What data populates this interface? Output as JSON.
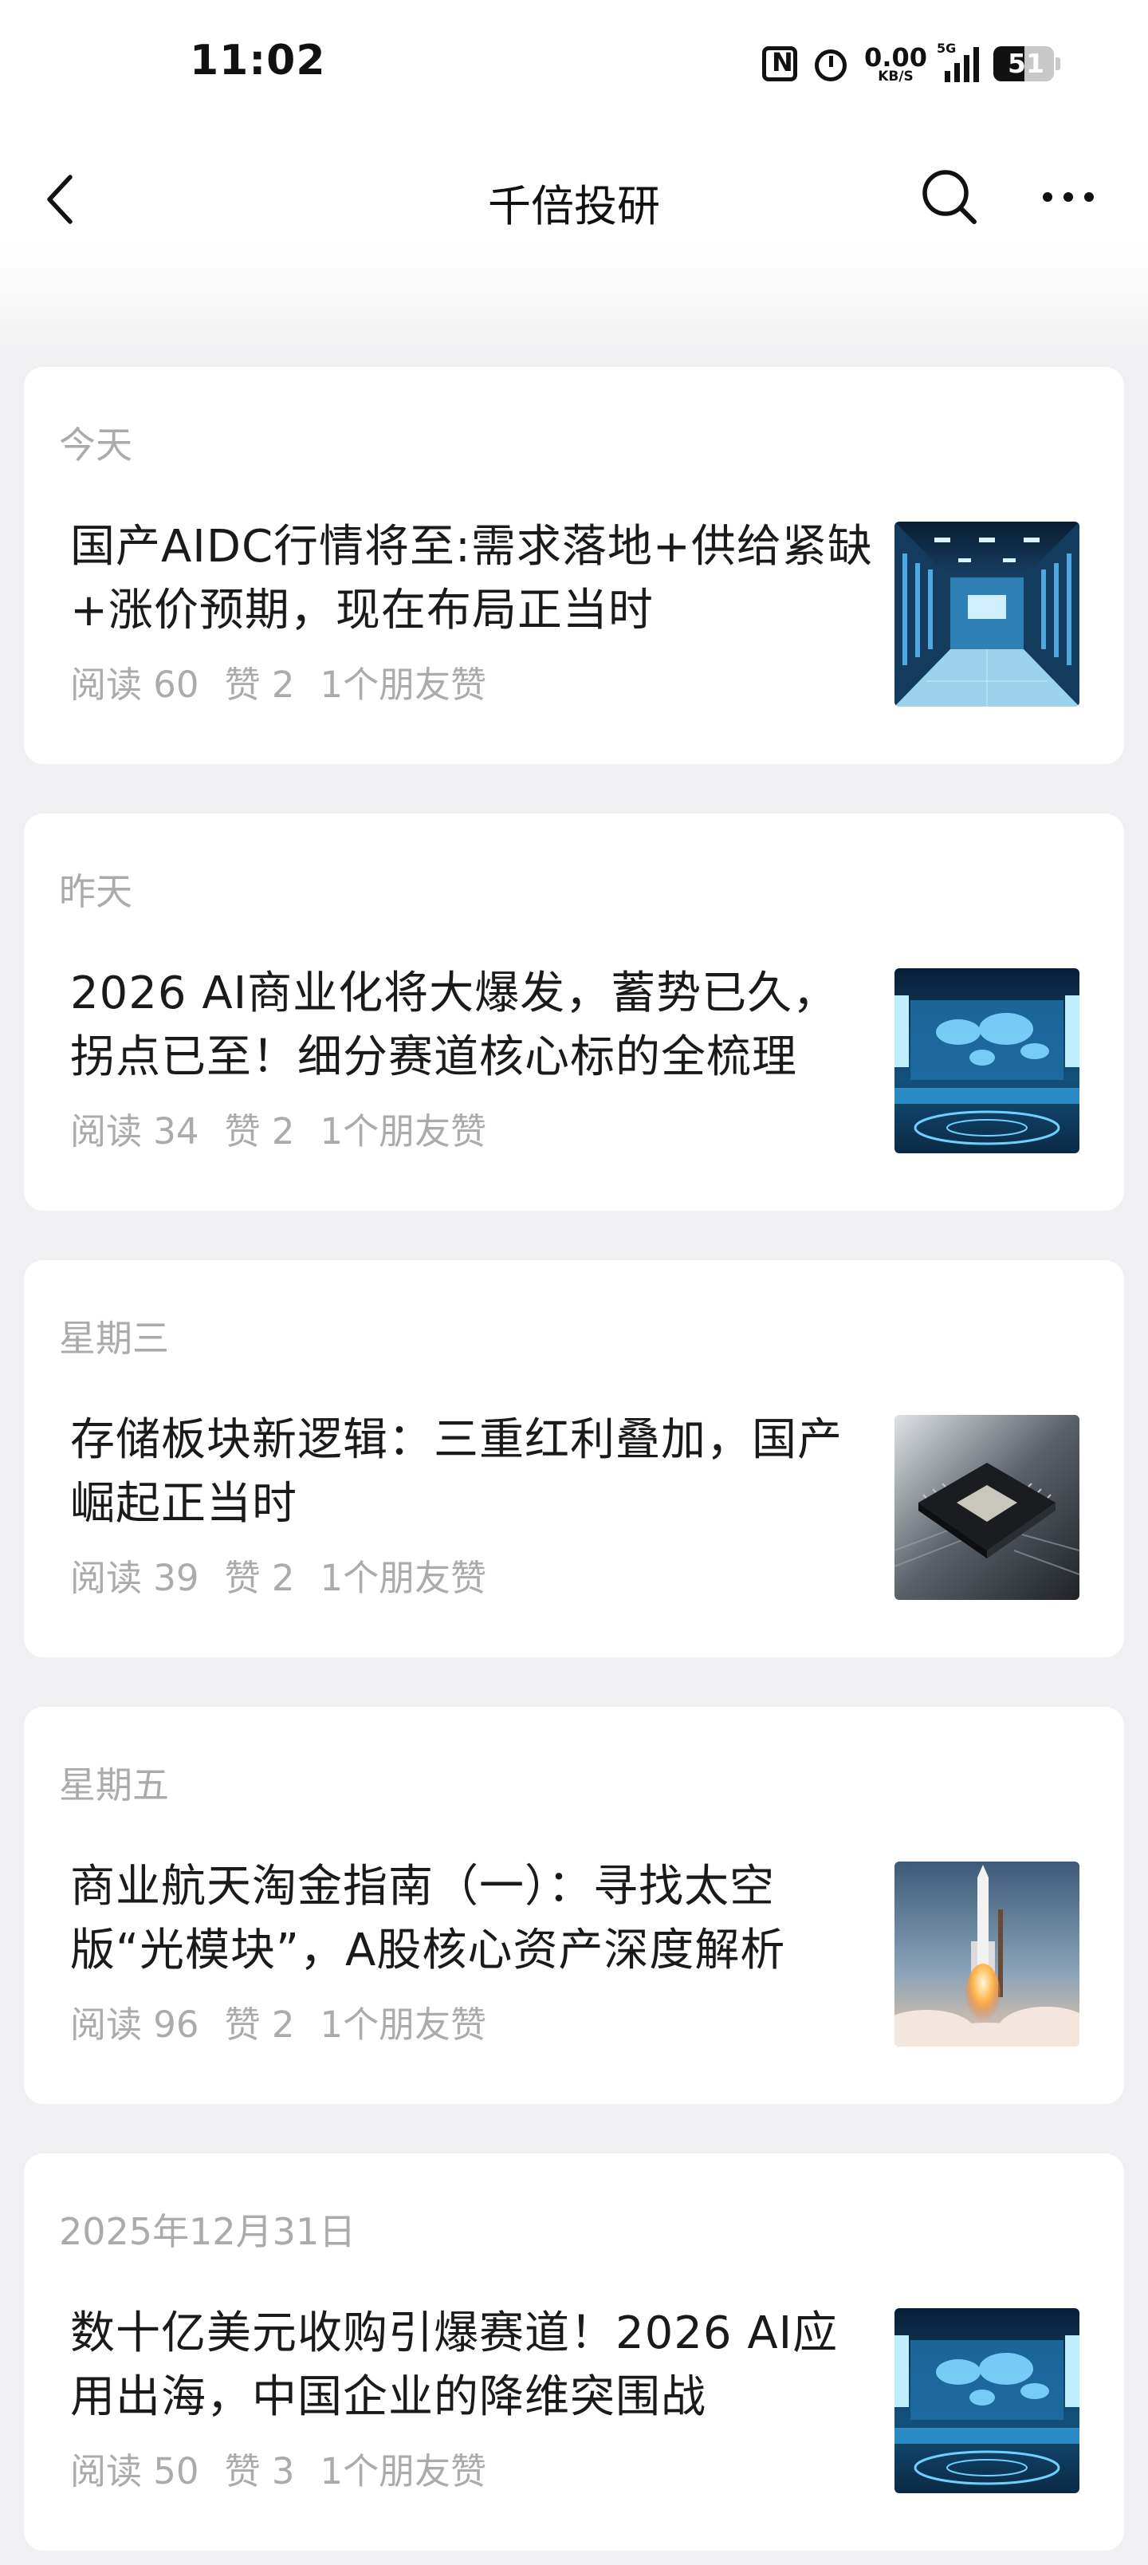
{
  "status": {
    "time": "11:02",
    "net_speed_value": "0.00",
    "net_speed_unit": "KB/S",
    "network": "5G",
    "battery": "51",
    "battery_level_percent": 51
  },
  "nav": {
    "title": "千倍投研"
  },
  "articles": [
    {
      "date": "今天",
      "title": "国产AIDC行情将至:需求落地+供给紧缺+涨价预期，现在布局正当时",
      "reads": "阅读 60",
      "likes": "赞 2",
      "friends": "1个朋友赞",
      "image": "data-center-corridor"
    },
    {
      "date": "昨天",
      "title": "2026 AI商业化将大爆发，蓄势已久，拐点已至！细分赛道核心标的全梳理",
      "reads": "阅读 34",
      "likes": "赞 2",
      "friends": "1个朋友赞",
      "image": "ai-control-room"
    },
    {
      "date": "星期三",
      "title": "存储板块新逻辑：三重红利叠加，国产崛起正当时",
      "reads": "阅读 39",
      "likes": "赞 2",
      "friends": "1个朋友赞",
      "image": "chip-on-board"
    },
    {
      "date": "星期五",
      "title": "商业航天淘金指南（一）：寻找太空版“光模块”，A股核心资产深度解析",
      "reads": "阅读 96",
      "likes": "赞 2",
      "friends": "1个朋友赞",
      "image": "rocket-launch"
    },
    {
      "date": "2025年12月31日",
      "title": "数十亿美元收购引爆赛道！2026 AI应用出海，中国企业的降维突围战",
      "reads": "阅读 50",
      "likes": "赞 3",
      "friends": "1个朋友赞",
      "image": "ai-control-room"
    }
  ]
}
